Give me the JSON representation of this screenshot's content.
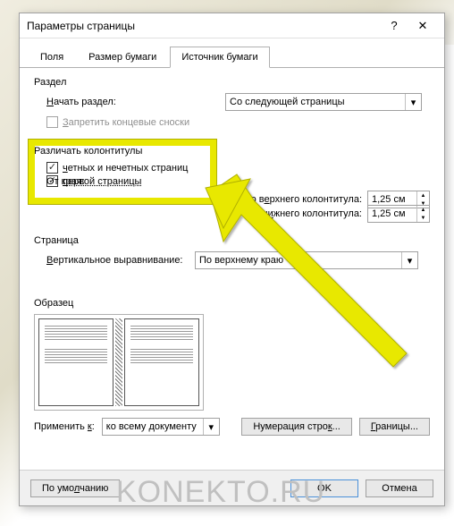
{
  "titlebar": {
    "title": "Параметры страницы",
    "help": "?",
    "close": "✕"
  },
  "tabs": {
    "t1": "Поля",
    "t2": "Размер бумаги",
    "t3": "Источник бумаги"
  },
  "section": {
    "label": "Раздел",
    "start_label": "Начать раздел:",
    "start_value": "Со следующей страницы",
    "suppress_label": "Запретить концевые сноски"
  },
  "hdrfoot": {
    "label": "Различать колонтитулы",
    "odd_even": "четных и нечетных страниц",
    "first_page": "первой страницы",
    "from_edge": "От края:",
    "to_header": "до верхнего колонтитула:",
    "to_footer": "до нижнего колонтитула:",
    "header_val": "1,25 см",
    "footer_val": "1,25 см"
  },
  "page": {
    "label": "Страница",
    "valign_label": "Вертикальное выравнивание:",
    "valign_value": "По верхнему краю"
  },
  "preview": {
    "label": "Образец"
  },
  "apply": {
    "label": "Применить к:",
    "value": "ко всему документу",
    "line_num": "Нумерация строк...",
    "borders": "Границы..."
  },
  "footer": {
    "default": "По умолчанию",
    "ok": "OK",
    "cancel": "Отмена"
  },
  "watermark": "KONEKTO.RU"
}
